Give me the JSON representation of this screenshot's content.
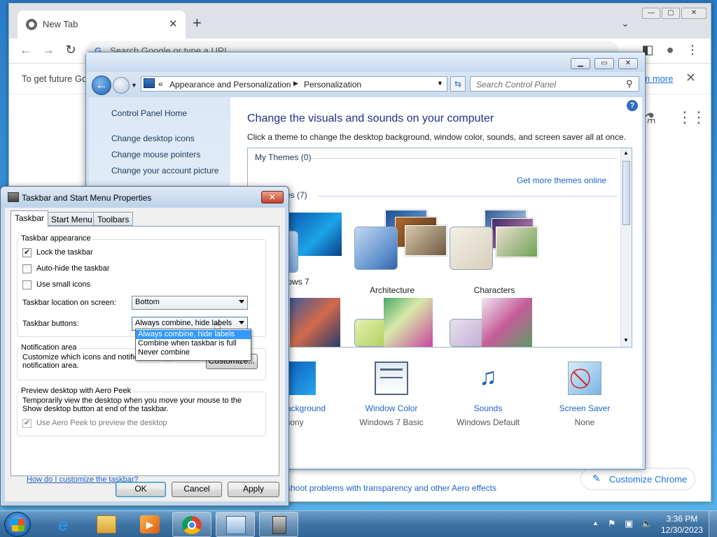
{
  "chrome": {
    "tab_title": "New Tab",
    "omnibox_placeholder": "Search Google or type a URL",
    "omnibox_g": "G",
    "infobar_message": "To get future Go",
    "infobar_link": "n more",
    "customize_label": "Customize Chrome"
  },
  "control_panel": {
    "breadcrumb_prefix": "«",
    "breadcrumb": [
      "Appearance and Personalization",
      "Personalization"
    ],
    "search_placeholder": "Search Control Panel",
    "left_links": [
      "Control Panel Home",
      "Change desktop icons",
      "Change mouse pointers",
      "Change your account picture"
    ],
    "heading": "Change the visuals and sounds on your computer",
    "description": "Click a theme to change the desktop background, window color, sounds, and screen saver all at once.",
    "my_themes": "My Themes (0)",
    "get_more": "Get more themes online",
    "aero_group": "mes (7)",
    "themes": [
      "indows 7",
      "Architecture",
      "Characters"
    ],
    "bottom_items": [
      {
        "label": "Background",
        "sub": "rmony"
      },
      {
        "label": "Window Color",
        "sub": "Windows 7 Basic"
      },
      {
        "label": "Sounds",
        "sub": "Windows Default"
      },
      {
        "label": "Screen Saver",
        "sub": "None"
      }
    ],
    "troubleshoot": "shoot problems with transparency and other Aero effects"
  },
  "taskbar_dialog": {
    "title": "Taskbar and Start Menu Properties",
    "tabs": [
      "Taskbar",
      "Start Menu",
      "Toolbars"
    ],
    "appearance_group": "Taskbar appearance",
    "lock_label": "Lock the taskbar",
    "lock_checked": true,
    "autohide_label": "Auto-hide the taskbar",
    "autohide_checked": false,
    "small_icons_label": "Use small icons",
    "small_icons_checked": false,
    "location_label": "Taskbar location on screen:",
    "location_value": "Bottom",
    "buttons_label": "Taskbar buttons:",
    "buttons_value": "Always combine, hide labels",
    "buttons_options": [
      "Always combine, hide labels",
      "Combine when taskbar is full",
      "Never combine"
    ],
    "notification_group": "Notification area",
    "notification_text": "Customize which icons and notifications appear in the notification area.",
    "customize_button": "Customize...",
    "peek_group": "Preview desktop with Aero Peek",
    "peek_text": "Temporarily view the desktop when you move your mouse to the Show desktop button at end of the taskbar.",
    "peek_label": "Use Aero Peek to preview the desktop",
    "peek_checked": true,
    "help_link": "How do I customize the taskbar?",
    "ok": "OK",
    "cancel": "Cancel",
    "apply": "Apply"
  },
  "taskbar": {
    "time": "3:36 PM",
    "date": "12/30/2023",
    "pinned": [
      "internet-explorer",
      "windows-explorer",
      "media-player",
      "chrome",
      "control-panel",
      "taskbar-properties"
    ]
  }
}
